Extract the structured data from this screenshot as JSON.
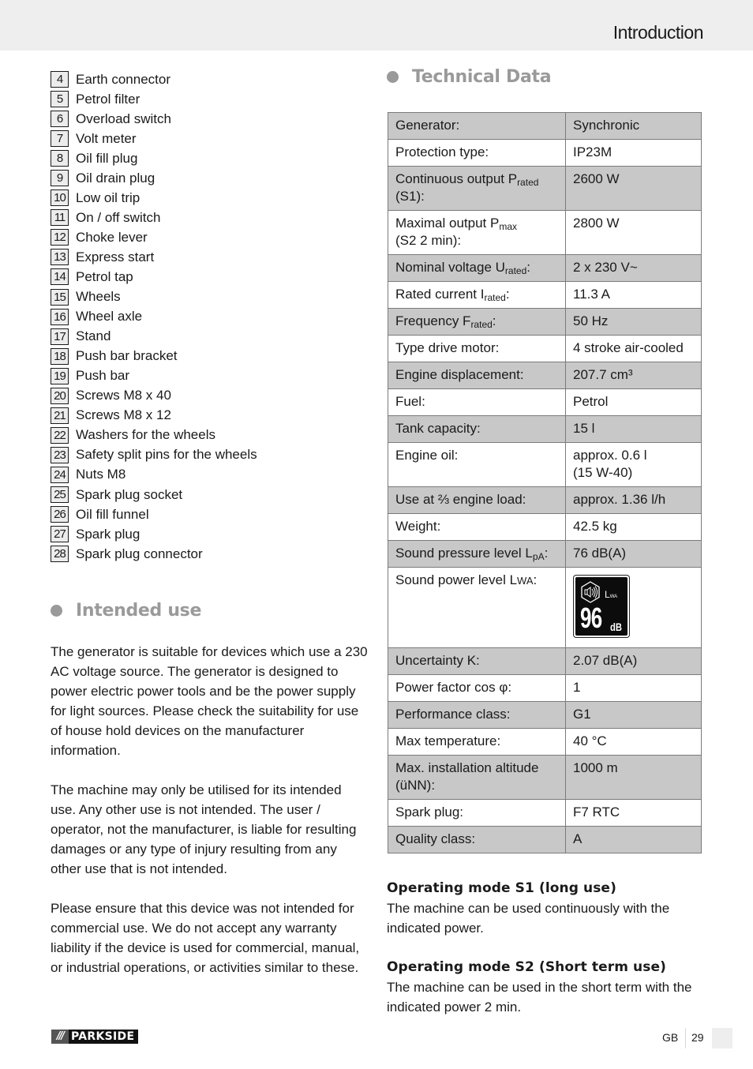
{
  "header": {
    "title": "Introduction"
  },
  "parts": [
    {
      "num": "4",
      "label": "Earth connector"
    },
    {
      "num": "5",
      "label": "Petrol filter"
    },
    {
      "num": "6",
      "label": "Overload switch"
    },
    {
      "num": "7",
      "label": "Volt meter"
    },
    {
      "num": "8",
      "label": "Oil fill plug"
    },
    {
      "num": "9",
      "label": "Oil drain plug"
    },
    {
      "num": "10",
      "label": "Low oil trip"
    },
    {
      "num": "11",
      "label": "On / off switch"
    },
    {
      "num": "12",
      "label": "Choke lever"
    },
    {
      "num": "13",
      "label": "Express start"
    },
    {
      "num": "14",
      "label": "Petrol tap"
    },
    {
      "num": "15",
      "label": "Wheels"
    },
    {
      "num": "16",
      "label": "Wheel axle"
    },
    {
      "num": "17",
      "label": "Stand"
    },
    {
      "num": "18",
      "label": "Push bar bracket"
    },
    {
      "num": "19",
      "label": "Push bar"
    },
    {
      "num": "20",
      "label": "Screws M8 x 40"
    },
    {
      "num": "21",
      "label": "Screws M8 x 12"
    },
    {
      "num": "22",
      "label": "Washers for the wheels"
    },
    {
      "num": "23",
      "label": "Safety split pins for the wheels"
    },
    {
      "num": "24",
      "label": "Nuts M8"
    },
    {
      "num": "25",
      "label": "Spark plug socket"
    },
    {
      "num": "26",
      "label": "Oil fill funnel"
    },
    {
      "num": "27",
      "label": "Spark plug"
    },
    {
      "num": "28",
      "label": "Spark plug connector"
    }
  ],
  "intended_use": {
    "heading": "Intended use",
    "paragraphs": [
      "The generator is suitable for devices which use a 230 AC voltage source. The generator is designed to power electric power tools and be the power supply for light sources. Please check the suitability for use of house hold devices on the manufacturer information.",
      "The machine may only be utilised for its intended use. Any other use is not intended. The user / operator, not the manufacturer, is liable for resulting damages or any type of injury resulting from any other use that is not intended.",
      "Please ensure that this device was not intended for commercial use. We do not accept any warranty liability if the device is used for commercial, manual, or industrial operations, or activities similar to these."
    ]
  },
  "technical_data": {
    "heading": "Technical Data",
    "rows": [
      {
        "key": "Generator:",
        "value": "Synchronic"
      },
      {
        "key": "Protection type:",
        "value": "IP23M"
      },
      {
        "key_main": "Continuous output P",
        "key_sub": "rated",
        "key_tail": " (S1):",
        "value": "2600 W"
      },
      {
        "key_main": "Maximal output P",
        "key_sub": "max",
        "key_tail": " (S2 2 min):",
        "value": "2800 W"
      },
      {
        "key_main": "Nominal voltage U",
        "key_sub": "rated",
        "key_tail": ":",
        "value": "2 x 230 V~"
      },
      {
        "key_main": "Rated current I",
        "key_sub": "rated",
        "key_tail": ":",
        "value": "11.3 A"
      },
      {
        "key_main": "Frequency F",
        "key_sub": "rated",
        "key_tail": ":",
        "value": "50 Hz"
      },
      {
        "key": "Type drive motor:",
        "value": "4 stroke air-cooled"
      },
      {
        "key": "Engine displacement:",
        "value": "207.7 cm³"
      },
      {
        "key": "Fuel:",
        "value": "Petrol"
      },
      {
        "key": "Tank capacity:",
        "value": "15 l"
      },
      {
        "key": "Engine oil:",
        "value": "approx. 0.6 l",
        "value_line2": "(15 W-40)"
      },
      {
        "key": "Use at ⅔ engine load:",
        "value": "approx. 1.36 l/h"
      },
      {
        "key": "Weight:",
        "value": "42.5 kg"
      },
      {
        "key_main": "Sound pressure level L",
        "key_sub": "pA",
        "key_tail": ":",
        "value": "76 dB(A)"
      },
      {
        "key_main": "Sound power level L",
        "key_sc": "WA",
        "key_tail": ":",
        "badge": {
          "label": "L",
          "label_sub": "WA",
          "value": "96",
          "unit": "dB"
        }
      },
      {
        "key": "Uncertainty K:",
        "value": "2.07 dB(A)"
      },
      {
        "key": "Power factor cos φ:",
        "value": "1"
      },
      {
        "key": "Performance class:",
        "value": "G1"
      },
      {
        "key": "Max temperature:",
        "value": "40 °C"
      },
      {
        "key": "Max. installation altitude (üNN):",
        "value": "1000 m"
      },
      {
        "key": "Spark plug:",
        "value": "F7 RTC"
      },
      {
        "key": "Quality class:",
        "value": "A"
      }
    ]
  },
  "operating_modes": [
    {
      "title": "Operating mode S1 (long use)",
      "text": "The machine can be used continuously with the indicated power."
    },
    {
      "title": "Operating mode S2 (Short term use)",
      "text": "The machine can be used in the short term with the indicated power 2 min."
    }
  ],
  "footer": {
    "brand_slashes": "///",
    "brand": "PARKSIDE",
    "language": "GB",
    "page_number": "29"
  }
}
